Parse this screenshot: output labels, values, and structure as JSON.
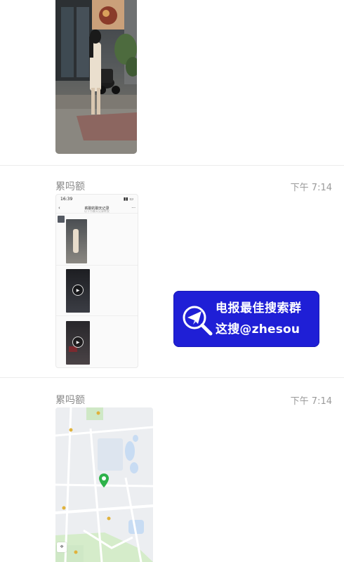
{
  "messages": [
    {
      "sender": "累吗额",
      "time": "下午 7:14",
      "chat_preview": {
        "status_time": "16:39",
        "title": "薪聊的聊天记录",
        "subtitle": "以下为聊天记录转发"
      }
    },
    {
      "sender": "累吗额",
      "time": "下午 7:14"
    }
  ],
  "banner": {
    "line1": "电报最佳搜索群",
    "line2": "这搜@zhesou",
    "bg_color": "#1f1fd6"
  },
  "icons": [
    "play-icon",
    "location-pin-icon",
    "locate-icon",
    "telegram-search-logo-icon"
  ]
}
